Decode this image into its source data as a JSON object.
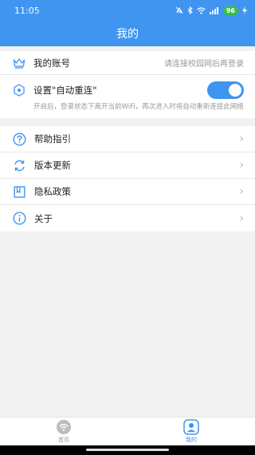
{
  "status_bar": {
    "time": "11:05",
    "battery": "96"
  },
  "header": {
    "title": "我的"
  },
  "account": {
    "title": "我的账号",
    "hint": "请连接校园网后再登录"
  },
  "auto_reconnect": {
    "title": "设置\"自动重连\"",
    "enabled": true,
    "description": "开启后，登录状态下离开当前WiFi，再次进入时将自动重新连接此网络"
  },
  "menu": [
    {
      "label": "帮助指引",
      "icon": "help-icon"
    },
    {
      "label": "版本更新",
      "icon": "refresh-icon"
    },
    {
      "label": "隐私政策",
      "icon": "book-icon"
    },
    {
      "label": "关于",
      "icon": "info-icon"
    }
  ],
  "bottom_nav": [
    {
      "label": "首页",
      "icon": "wifi-icon",
      "active": false
    },
    {
      "label": "我的",
      "icon": "person-icon",
      "active": true
    }
  ],
  "colors": {
    "primary": "#3f95f0",
    "background": "#f2f2f2"
  }
}
